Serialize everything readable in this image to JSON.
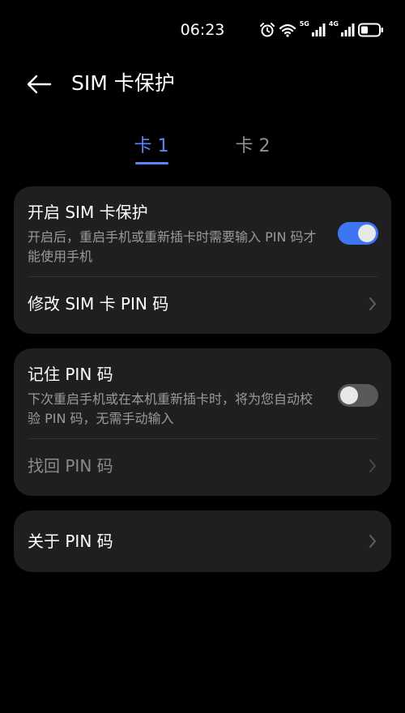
{
  "status_bar": {
    "time": "06:23",
    "network_5g": "5G",
    "network_4g": "4G"
  },
  "header": {
    "title": "SIM 卡保护",
    "back_icon": "arrow-left-icon"
  },
  "tabs": [
    {
      "label": "卡 1",
      "selected": true
    },
    {
      "label": "卡 2",
      "selected": false
    }
  ],
  "colors": {
    "accent": "#3d76f0",
    "tab_active": "#5b86f7",
    "card_bg": "#1f1f21",
    "background": "#000000"
  },
  "card1": {
    "protect_title": "开启 SIM 卡保护",
    "protect_desc": "开启后，重启手机或重新插卡时需要输入 PIN 码才能使用手机",
    "protect_enabled": true,
    "change_pin_label": "修改 SIM 卡 PIN 码"
  },
  "card2": {
    "remember_title": "记住 PIN 码",
    "remember_desc": "下次重启手机或在本机重新插卡时，将为您自动校验 PIN 码，无需手动输入",
    "remember_enabled": false,
    "recover_label": "找回 PIN 码"
  },
  "card3": {
    "about_label": "关于 PIN 码"
  }
}
